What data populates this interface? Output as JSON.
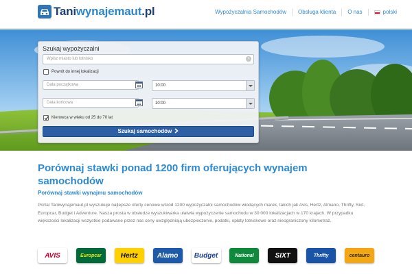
{
  "header": {
    "logo_part1": "Tani",
    "logo_part2": "wynajemaut",
    "logo_part3": ".pl",
    "nav": [
      {
        "label": "Wypożyczalnia Samochodów"
      },
      {
        "label": "Obsługa klienta"
      },
      {
        "label": "O nas"
      },
      {
        "label": "polski"
      }
    ]
  },
  "search": {
    "title": "Szukaj wypożyczalni",
    "location_placeholder": "Wpisz miasto lub lotnisko",
    "return_other_label": "Powrót do innej lokalizacji",
    "pickup_date_placeholder": "Data początkowa",
    "pickup_time": "10:00",
    "dropoff_date_placeholder": "Data końcowa",
    "dropoff_time": "10:00",
    "driver_age_label": "Kierowca w wieku od 25 do 70 lat",
    "button_label": "Szukaj samochodów"
  },
  "content": {
    "title": "Porównaj stawki ponad 1200 firm oferujących wynajem samochodów",
    "subtitle": "Porównaj stawki wynajmu samochodów",
    "body": "Portal Taniwynajemaut.pl wyszukuje najlepsze oferty cenowe wśród 1200 wypożyczalni samochodów wiodących marek, takich jak Avis, Hertz, Almano, Thrifty, Sixt, Europcar, Budget i Adventure. Nasza prosta w obsłudze wyszukiwarka ułatwia wypożyczenie samochodu w 30 000 lokalizacjach w 170 krajach.  W przypadku większości lokalizacji wszystkie podawane przez nas ceny uwzględniają ubezpieczenie, podatki, opłaty lotniskowe oraz nieograniczony kilometraż."
  },
  "brands": [
    {
      "name": "AVIS",
      "bg": "#ffffff",
      "fg": "#d4002a"
    },
    {
      "name": "Europcar",
      "bg": "#006a3a",
      "fg": "#f2e600"
    },
    {
      "name": "Hertz",
      "bg": "#ffd100",
      "fg": "#111111"
    },
    {
      "name": "Alamo",
      "bg": "#1d5aa8",
      "fg": "#ffffff"
    },
    {
      "name": "Budget",
      "bg": "#ffffff",
      "fg": "#1c3f94"
    },
    {
      "name": "National",
      "bg": "#0f8a3c",
      "fg": "#ffffff"
    },
    {
      "name": "SIXT",
      "bg": "#111111",
      "fg": "#ffffff"
    },
    {
      "name": "Thrifty",
      "bg": "#1a54a6",
      "fg": "#ffffff"
    },
    {
      "name": "centauro",
      "bg": "#f3a712",
      "fg": "#2a2a2a"
    }
  ],
  "colors": {
    "accent": "#2e8ad0",
    "button": "#2d5fa5",
    "logo_dark": "#1d3f72"
  }
}
